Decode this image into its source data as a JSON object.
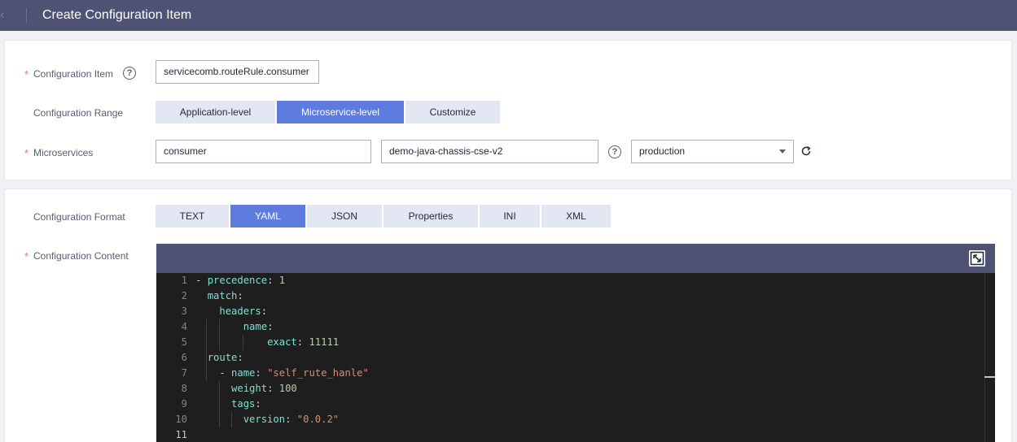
{
  "header": {
    "title": "Create Configuration Item"
  },
  "form": {
    "required_mark": "*",
    "config_item": {
      "label": "Configuration Item",
      "value": "servicecomb.routeRule.consumer"
    },
    "config_range": {
      "label": "Configuration Range",
      "options": [
        "Application-level",
        "Microservice-level",
        "Customize"
      ],
      "selected": "Microservice-level"
    },
    "microservices": {
      "label": "Microservices",
      "service_name": "consumer",
      "app_name": "demo-java-chassis-cse-v2",
      "environment": "production"
    },
    "config_format": {
      "label": "Configuration Format",
      "options": [
        "TEXT",
        "YAML",
        "JSON",
        "Properties",
        "INI",
        "XML"
      ],
      "selected": "YAML"
    },
    "config_content": {
      "label": "Configuration Content"
    }
  },
  "editor": {
    "current_line": 11,
    "lines": [
      {
        "num": "1",
        "text": "- precedence: 1"
      },
      {
        "num": "2",
        "text": "  match:"
      },
      {
        "num": "3",
        "text": "    headers:"
      },
      {
        "num": "4",
        "text": "        name:"
      },
      {
        "num": "5",
        "text": "            exact: 11111"
      },
      {
        "num": "6",
        "text": "  route:"
      },
      {
        "num": "7",
        "text": "    - name: \"self_rute_hanle\""
      },
      {
        "num": "8",
        "text": "      weight: 100"
      },
      {
        "num": "9",
        "text": "      tags:"
      },
      {
        "num": "10",
        "text": "        version: \"0.0.2\""
      },
      {
        "num": "11",
        "text": ""
      }
    ]
  },
  "icons": {
    "back": "chevron-left-icon",
    "help": "question-circle-icon",
    "refresh": "refresh-icon",
    "expand": "expand-icon",
    "dropdown": "caret-down-icon"
  },
  "colors": {
    "header_bg": "#4e5373",
    "accent": "#5e7ce0",
    "segment_bg": "#e3e7f3",
    "required": "#f66f6a",
    "editor_bg": "#1e1e1e",
    "yaml_key": "#7ee0d2",
    "yaml_number": "#b5cea8",
    "yaml_string": "#ce9178"
  }
}
